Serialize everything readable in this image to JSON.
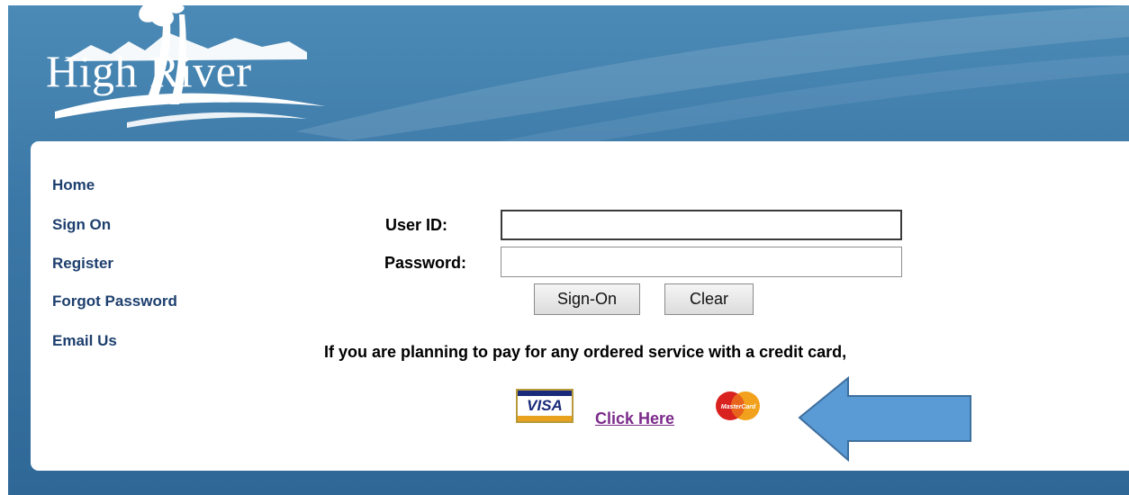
{
  "logo": {
    "text": "High River"
  },
  "nav": {
    "items": [
      {
        "label": "Home"
      },
      {
        "label": "Sign On"
      },
      {
        "label": "Register"
      },
      {
        "label": "Forgot Password"
      },
      {
        "label": "Email Us"
      }
    ]
  },
  "login": {
    "user_id_label": "User ID:",
    "user_id_value": "",
    "password_label": "Password:",
    "password_value": "",
    "signon_label": "Sign-On",
    "clear_label": "Clear"
  },
  "payment": {
    "notice": "If you are planning to pay for any ordered service with a credit card,",
    "link": "Click Here",
    "visa_text": "VISA",
    "mastercard_text": "MasterCard"
  },
  "colors": {
    "header_blue": "#3c78a7",
    "nav_text": "#1d3f6e",
    "link_visited": "#7b2a8a",
    "arrow_fill": "#5b9bd5",
    "arrow_stroke": "#3d6f9e"
  },
  "icons": [
    "river-logo-icon",
    "visa-icon",
    "mastercard-icon",
    "arrow-left-icon"
  ]
}
